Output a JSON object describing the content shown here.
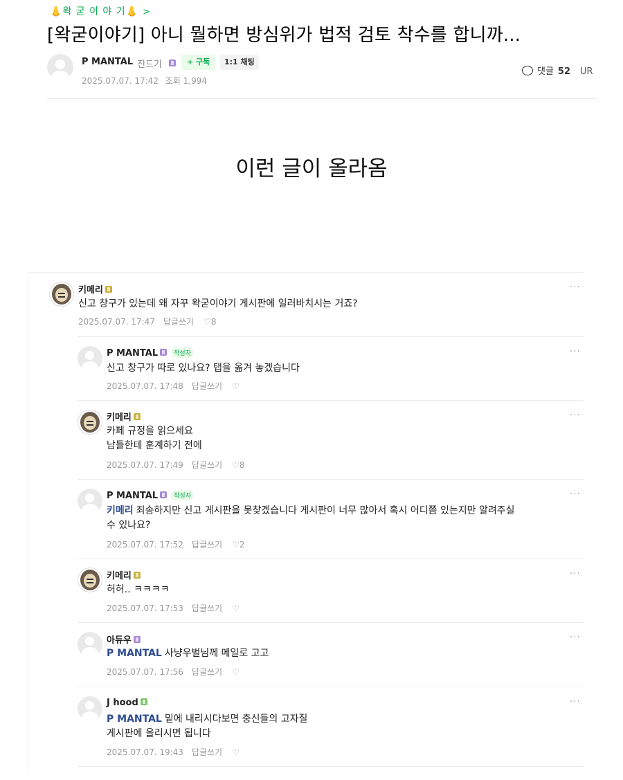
{
  "breadcrumb": {
    "label": "👃왁 굳 이 야 기👃",
    "chevron": ">"
  },
  "post": {
    "title": "[왁굳이야기] 아니 뭘하면 방심위가 법적 검토 착수를 합니까...",
    "author": "P MANTAL",
    "grade": "진드기",
    "subscribe_label": "+ 구독",
    "chat_label": "1:1 채팅",
    "date": "2025.07.07. 17:42",
    "views_label": "조회 1,994",
    "comments_label": "댓글",
    "comments_count": "52",
    "url_label": "UR"
  },
  "caption": "이런 글이 올라옴",
  "comments": [
    {
      "author": "키메리",
      "text": [
        "신고 창구가 있는데 왜 자꾸 왁굳이야기 게시판에 일러바치시는 거죠?"
      ],
      "date": "2025.07.07. 17:47",
      "reply": "답글쓰기",
      "likes": "♡8"
    },
    {
      "author": "P MANTAL",
      "writer_tag": "작성자",
      "text": [
        "신고 창구가 따로 있나요? 탭을 옮겨 놓겠습니다"
      ],
      "date": "2025.07.07. 17:48",
      "reply": "답글쓰기",
      "likes": "♡"
    },
    {
      "author": "키메리",
      "text": [
        "카페 규정을 읽으세요",
        "남들한테 훈계하기 전에"
      ],
      "date": "2025.07.07. 17:49",
      "reply": "답글쓰기",
      "likes": "♡8"
    },
    {
      "author": "P MANTAL",
      "writer_tag": "작성자",
      "mention": "키메리",
      "text": [
        "죄송하지만 신고 게시판을 못찾겠습니다 게시판이 너무 많아서 혹시 어디쯤 있는지만 알려주실",
        "수 있나요?"
      ],
      "date": "2025.07.07. 17:52",
      "reply": "답글쓰기",
      "likes": "♡2"
    },
    {
      "author": "키메리",
      "text": [
        "허허.. ㅋㅋㅋㅋ"
      ],
      "date": "2025.07.07. 17:53",
      "reply": "답글쓰기",
      "likes": "♡"
    },
    {
      "author": "아듀우",
      "mention": "P MANTAL",
      "text": [
        "사냥우벌님께 메일로 고고"
      ],
      "date": "2025.07.07. 17:56",
      "reply": "답글쓰기",
      "likes": "♡"
    },
    {
      "author": "J hood",
      "mention": "P MANTAL",
      "text": [
        "밑에 내리시다보면 충신들의 고자질",
        "게시판에 올리시면 됩니다"
      ],
      "date": "2025.07.07. 19:43",
      "reply": "답글쓰기",
      "likes": "♡"
    }
  ],
  "more_label": "···",
  "colors": {
    "accent": "#03a94e",
    "mention": "#2e4b8f",
    "badge_purple": "#a58ad6",
    "badge_gold": "#c9b03a",
    "badge_green": "#7dc26b"
  }
}
